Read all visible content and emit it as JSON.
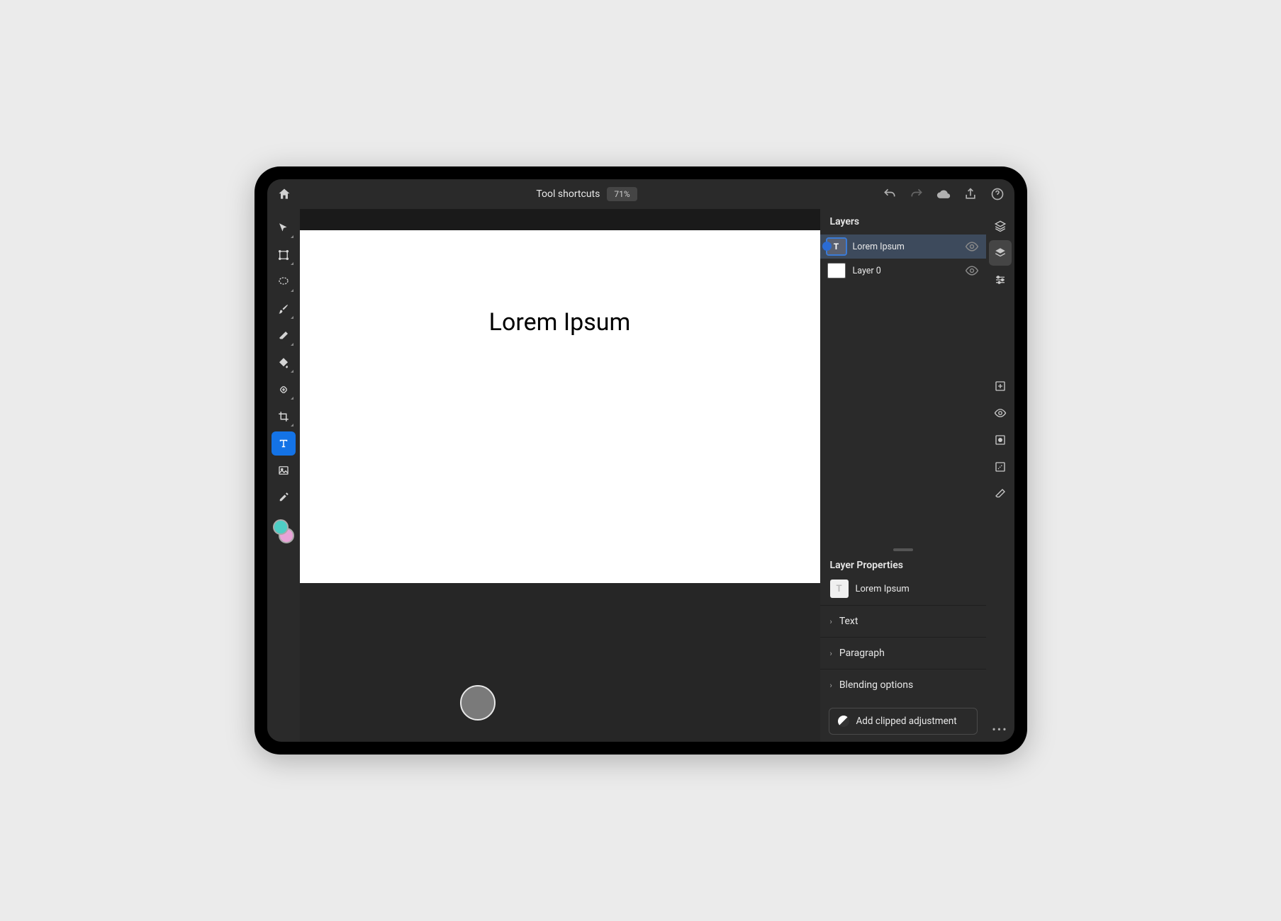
{
  "header": {
    "title": "Tool shortcuts",
    "zoom": "71%"
  },
  "canvas": {
    "text": "Lorem Ipsum"
  },
  "layers": {
    "title": "Layers",
    "items": [
      {
        "name": "Lorem Ipsum",
        "type": "text",
        "selected": true
      },
      {
        "name": "Layer 0",
        "type": "image",
        "selected": false
      }
    ]
  },
  "properties": {
    "title": "Layer Properties",
    "layerName": "Lorem Ipsum",
    "sections": [
      {
        "label": "Text"
      },
      {
        "label": "Paragraph"
      },
      {
        "label": "Blending options"
      }
    ],
    "addAdjustment": "Add clipped adjustment"
  },
  "colors": {
    "foreground": "#4ecdc4",
    "background": "#e8a3d8"
  }
}
